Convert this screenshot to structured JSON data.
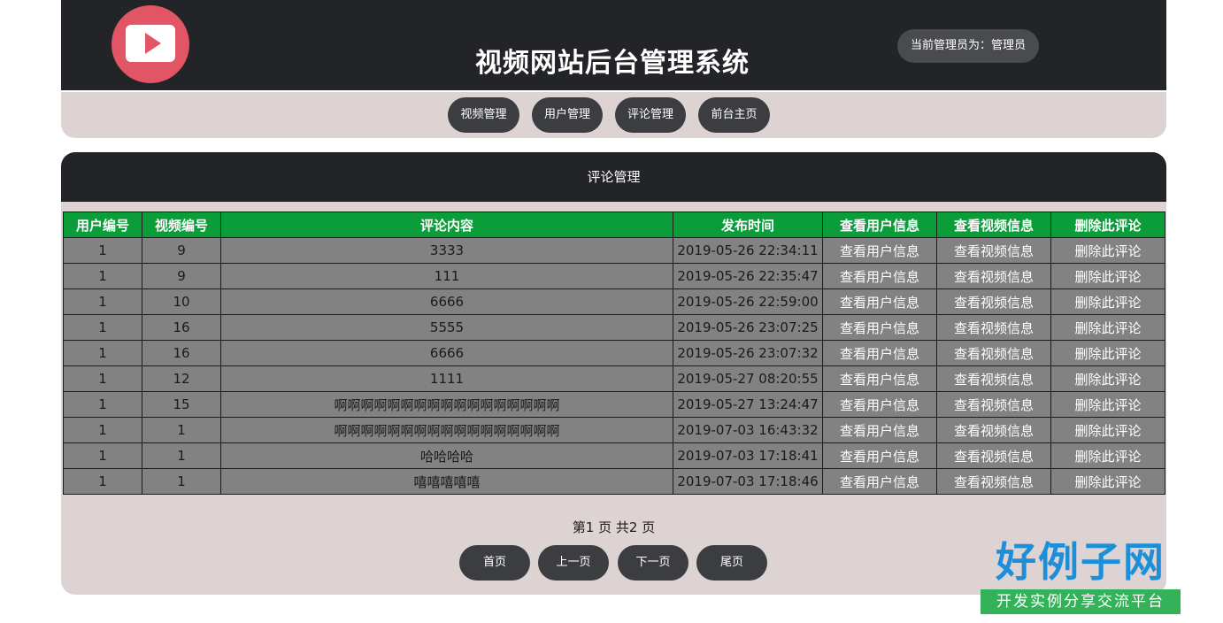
{
  "header": {
    "title": "视频网站后台管理系统",
    "admin_label": "当前管理员为：管理员"
  },
  "nav": {
    "items": [
      {
        "label": "视频管理"
      },
      {
        "label": "用户管理"
      },
      {
        "label": "评论管理"
      },
      {
        "label": "前台主页"
      }
    ]
  },
  "panel": {
    "title": "评论管理"
  },
  "table": {
    "columns": [
      "用户编号",
      "视频编号",
      "评论内容",
      "发布时间",
      "查看用户信息",
      "查看视频信息",
      "删除此评论"
    ],
    "rows": [
      {
        "user_id": "1",
        "video_id": "9",
        "content": "3333",
        "time": "2019-05-26 22:34:11",
        "view_user": "查看用户信息",
        "view_video": "查看视频信息",
        "delete": "删除此评论"
      },
      {
        "user_id": "1",
        "video_id": "9",
        "content": "111",
        "time": "2019-05-26 22:35:47",
        "view_user": "查看用户信息",
        "view_video": "查看视频信息",
        "delete": "删除此评论"
      },
      {
        "user_id": "1",
        "video_id": "10",
        "content": "6666",
        "time": "2019-05-26 22:59:00",
        "view_user": "查看用户信息",
        "view_video": "查看视频信息",
        "delete": "删除此评论"
      },
      {
        "user_id": "1",
        "video_id": "16",
        "content": "5555",
        "time": "2019-05-26 23:07:25",
        "view_user": "查看用户信息",
        "view_video": "查看视频信息",
        "delete": "删除此评论"
      },
      {
        "user_id": "1",
        "video_id": "16",
        "content": "6666",
        "time": "2019-05-26 23:07:32",
        "view_user": "查看用户信息",
        "view_video": "查看视频信息",
        "delete": "删除此评论"
      },
      {
        "user_id": "1",
        "video_id": "12",
        "content": "1111",
        "time": "2019-05-27 08:20:55",
        "view_user": "查看用户信息",
        "view_video": "查看视频信息",
        "delete": "删除此评论"
      },
      {
        "user_id": "1",
        "video_id": "15",
        "content": "啊啊啊啊啊啊啊啊啊啊啊啊啊啊啊啊啊",
        "time": "2019-05-27 13:24:47",
        "view_user": "查看用户信息",
        "view_video": "查看视频信息",
        "delete": "删除此评论"
      },
      {
        "user_id": "1",
        "video_id": "1",
        "content": "啊啊啊啊啊啊啊啊啊啊啊啊啊啊啊啊啊",
        "time": "2019-07-03 16:43:32",
        "view_user": "查看用户信息",
        "view_video": "查看视频信息",
        "delete": "删除此评论"
      },
      {
        "user_id": "1",
        "video_id": "1",
        "content": "哈哈哈哈",
        "time": "2019-07-03 17:18:41",
        "view_user": "查看用户信息",
        "view_video": "查看视频信息",
        "delete": "删除此评论"
      },
      {
        "user_id": "1",
        "video_id": "1",
        "content": "嘻嘻嘻嘻嘻",
        "time": "2019-07-03 17:18:46",
        "view_user": "查看用户信息",
        "view_video": "查看视频信息",
        "delete": "删除此评论"
      }
    ]
  },
  "pagination": {
    "info": "第1 页  共2 页",
    "first": "首页",
    "prev": "上一页",
    "next": "下一页",
    "last": "尾页"
  },
  "brand": {
    "name": "好例子网",
    "tagline": "开发实例分享交流平台"
  },
  "icons": {
    "logo": "play-icon"
  },
  "colors": {
    "header_bg": "#232427",
    "panel_bg": "#dcd3d2",
    "table_header_bg": "#0b9d3a",
    "table_cell_bg": "#828282",
    "logo": "#e25565"
  }
}
